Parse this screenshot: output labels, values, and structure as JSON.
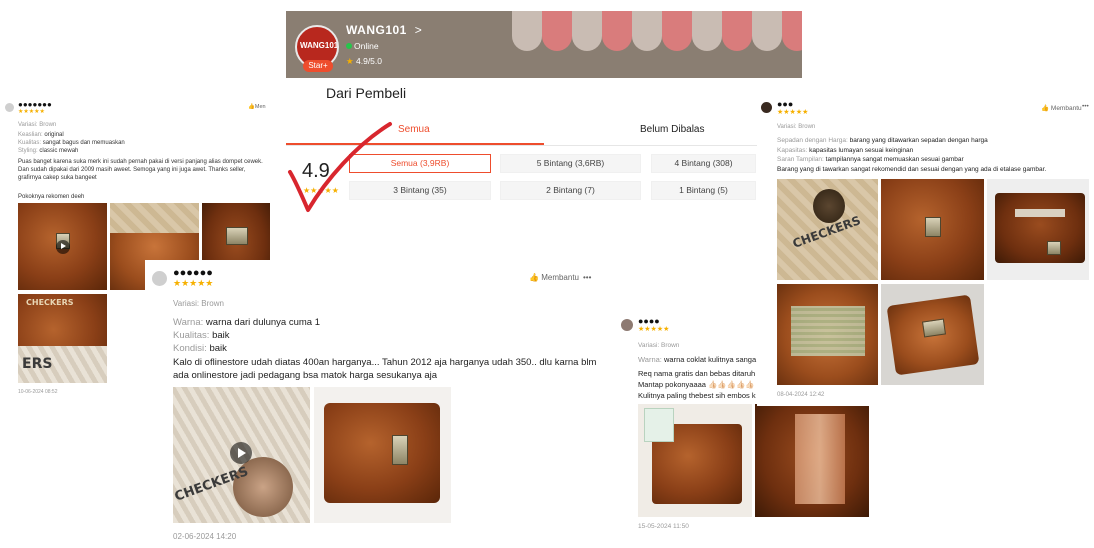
{
  "shop": {
    "name": "WANG101",
    "chevron": ">",
    "status": "Online",
    "rating": "4.9/5.0",
    "badge": "Star+",
    "avatar_text": "WANG101"
  },
  "ratings": {
    "section_title": "Dari Pembeli",
    "tabs": [
      "Semua",
      "Belum Dibalas"
    ],
    "score": "4.9",
    "filters": [
      "Semua (3,9RB)",
      "5 Bintang (3,6RB)",
      "4 Bintang (308)",
      "3 Bintang (35)",
      "2 Bintang (7)",
      "1 Bintang (5)"
    ]
  },
  "review_left": {
    "username": "●●●●●●●",
    "stars": "★★★★★",
    "helpful": "Men",
    "variant": "Variasi: Brown",
    "lines": [
      {
        "k": "Keaslian:",
        "v": "original"
      },
      {
        "k": "Kualitas:",
        "v": "sangat bagus dan memuaskan"
      },
      {
        "k": "Styling:",
        "v": "classic mewah"
      }
    ],
    "body": "Puas banget karena suka merk ini sudah pernah pakai di versi panjang alias dompet cewek. Dan sudah dipakai dari 2009 masih aweet. Semoga yang ini juga awet. Thanks seller, grafirnya cakep suka bangeet",
    "footer_line": "Pokoknya rekomen deeh",
    "date": "10-06-2024 08:52",
    "photo_text": "CHECKERS",
    "photo_text_2": "ERS"
  },
  "review_center": {
    "username": "●●●●●●",
    "stars": "★★★★★",
    "helpful": "Membantu",
    "more": "•••",
    "variant": "Variasi: Brown",
    "lines": [
      {
        "k": "Warna:",
        "v": "warna dari dulunya cuma 1"
      },
      {
        "k": "Kualitas:",
        "v": "baik"
      },
      {
        "k": "Kondisi:",
        "v": "baik"
      }
    ],
    "body": "Kalo di oflinestore udah diatas 400an harganya... Tahun 2012 aja harganya udah 350.. dlu karna blm ada onlinestore jadi pedagang bsa matok harga sesukanya aja",
    "date": "02-06-2024 14:20",
    "photo_text": "CHECKERS"
  },
  "review_mid_right": {
    "username": "●●●●",
    "stars": "★★★★★",
    "variant": "Variasi: Brown",
    "lines": [
      {
        "k": "Warna:",
        "v": "warna coklat kulitnya sanga"
      }
    ],
    "body_lines": [
      "Req nama gratis dan bebas ditaruh",
      "Mantap pokonyaaaa 👍🏻👍🏻👍🏻👍🏻👍🏻",
      "Kulitnya paling thebest sih embos k"
    ],
    "date": "15-05-2024 11:50"
  },
  "review_right": {
    "username": "●●●",
    "stars": "★★★★★",
    "helpful": "Membantu",
    "more": "•••",
    "variant": "Variasi: Brown",
    "lines": [
      {
        "k": "Sepadan dengan Harga:",
        "v": "barang yang ditawarkan sepadan dengan harga"
      },
      {
        "k": "Kapasitas:",
        "v": "kapasitas lumayan sesuai keinginan"
      },
      {
        "k": "Saran Tampilan:",
        "v": "tampilannya sangat memuaskan sesuai gambar"
      }
    ],
    "body": "Barang yang di tawarkan sangat rekomendid dan sesuai dengan yang ada di etalase gambar.",
    "date": "08-04-2024 12:42",
    "photo_text": "CHECKERS"
  },
  "icons": {
    "thumb": "thumbs-up-icon",
    "star": "star-icon",
    "play": "play-icon",
    "check": "check-mark-icon"
  },
  "colors": {
    "accent": "#ee4d2d",
    "star": "#f6b000",
    "online": "#26c64b"
  }
}
